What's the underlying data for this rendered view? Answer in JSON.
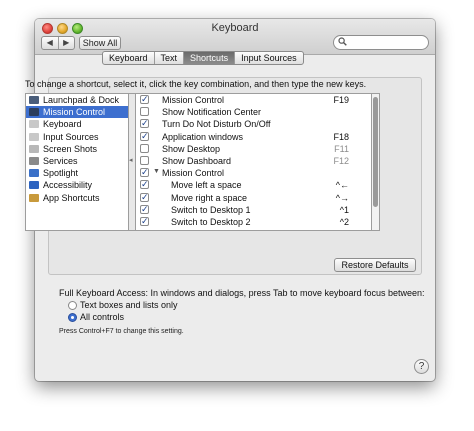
{
  "window": {
    "title": "Keyboard",
    "back_glyph": "◀",
    "forward_glyph": "▶",
    "show_all": "Show All",
    "search_icon": "search-icon",
    "search_placeholder": ""
  },
  "tabs": [
    {
      "label": "Keyboard",
      "active": false
    },
    {
      "label": "Text",
      "active": false
    },
    {
      "label": "Shortcuts",
      "active": true
    },
    {
      "label": "Input Sources",
      "active": false
    }
  ],
  "instruction": "To change a shortcut, select it, click the key combination, and then type the new keys.",
  "categories": [
    {
      "label": "Launchpad & Dock",
      "icon": "launchpad-icon",
      "color": "#4a5d7a",
      "selected": false
    },
    {
      "label": "Mission Control",
      "icon": "mission-control-icon",
      "color": "#2c3e5c",
      "selected": true
    },
    {
      "label": "Keyboard",
      "icon": "keyboard-icon",
      "color": "#c8c8c8",
      "selected": false
    },
    {
      "label": "Input Sources",
      "icon": "input-sources-icon",
      "color": "#c8c8c8",
      "selected": false
    },
    {
      "label": "Screen Shots",
      "icon": "screen-shots-icon",
      "color": "#b8b8b8",
      "selected": false
    },
    {
      "label": "Services",
      "icon": "services-icon",
      "color": "#8a8a8a",
      "selected": false
    },
    {
      "label": "Spotlight",
      "icon": "spotlight-icon",
      "color": "#3a70c8",
      "selected": false
    },
    {
      "label": "Accessibility",
      "icon": "accessibility-icon",
      "color": "#2d63c0",
      "selected": false
    },
    {
      "label": "App Shortcuts",
      "icon": "app-shortcuts-icon",
      "color": "#c89a3c",
      "selected": false
    }
  ],
  "shortcuts": [
    {
      "label": "Mission Control",
      "key": "F19",
      "checked": true,
      "dim": false
    },
    {
      "label": "Show Notification Center",
      "key": "",
      "checked": false,
      "dim": false
    },
    {
      "label": "Turn Do Not Disturb On/Off",
      "key": "",
      "checked": true,
      "dim": false
    },
    {
      "label": "Application windows",
      "key": "F18",
      "checked": true,
      "dim": false
    },
    {
      "label": "Show Desktop",
      "key": "F11",
      "checked": false,
      "dim": true
    },
    {
      "label": "Show Dashboard",
      "key": "F12",
      "checked": false,
      "dim": true
    },
    {
      "label": "Mission Control",
      "key": "",
      "checked": true,
      "dim": false,
      "group": true
    },
    {
      "label": "Move left a space",
      "key": "^←",
      "checked": true,
      "dim": false,
      "indent": true
    },
    {
      "label": "Move right a space",
      "key": "^→",
      "checked": true,
      "dim": false,
      "indent": true
    },
    {
      "label": "Switch to Desktop 1",
      "key": "^1",
      "checked": true,
      "dim": false,
      "indent": true
    },
    {
      "label": "Switch to Desktop 2",
      "key": "^2",
      "checked": true,
      "dim": false,
      "indent": true
    }
  ],
  "restore_defaults": "Restore Defaults",
  "full_keyboard_access": "Full Keyboard Access: In windows and dialogs, press Tab to move keyboard focus between:",
  "radio_options": [
    {
      "label": "Text boxes and lists only",
      "selected": false
    },
    {
      "label": "All controls",
      "selected": true
    }
  ],
  "note": "Press Control+F7 to change this setting.",
  "help": "?",
  "check_glyph": "✓",
  "disclosure_glyph": "▼"
}
